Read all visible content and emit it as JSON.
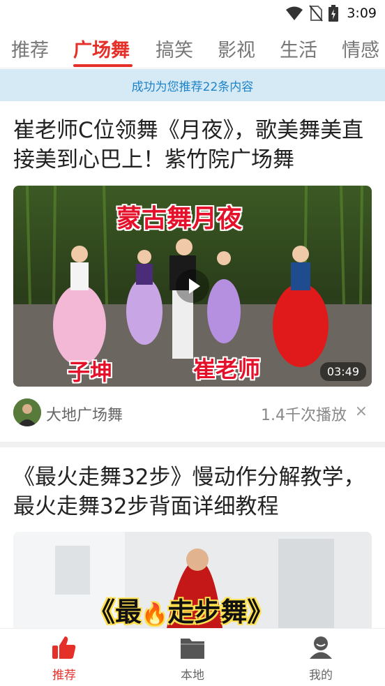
{
  "status_bar": {
    "time": "3:09",
    "icons": [
      "wifi-icon",
      "no-sim-icon",
      "battery-charging-icon"
    ]
  },
  "tabs": [
    {
      "label": "推荐",
      "active": false
    },
    {
      "label": "广场舞",
      "active": true
    },
    {
      "label": "搞笑",
      "active": false
    },
    {
      "label": "影视",
      "active": false
    },
    {
      "label": "生活",
      "active": false
    },
    {
      "label": "情感",
      "active": false
    }
  ],
  "notice": {
    "text": "成功为您推荐22条内容"
  },
  "feed": [
    {
      "title": "崔老师C位领舞《月夜》，歌美舞美直接美到心巴上！紫竹院广场舞",
      "overlay_title": "蒙古舞月夜",
      "overlay_left": "子坤",
      "overlay_right": "崔老师",
      "duration": "03:49",
      "author": "大地广场舞",
      "plays": "1.4千次播放",
      "close": "×"
    },
    {
      "title": "《最火走舞32步》慢动作分解教学，最火走舞32步背面详细教程",
      "overlay_title_a": "《最",
      "overlay_title_b": "走步舞》",
      "overlay_emoji": "🔥"
    }
  ],
  "bottom_nav": [
    {
      "label": "推荐",
      "icon": "thumbs-up-icon",
      "active": true
    },
    {
      "label": "本地",
      "icon": "folder-icon",
      "active": false
    },
    {
      "label": "我的",
      "icon": "user-icon",
      "active": false
    }
  ],
  "colors": {
    "accent": "#e5302a",
    "notice_bg": "#d6eaf6",
    "notice_text": "#1e83c9"
  }
}
